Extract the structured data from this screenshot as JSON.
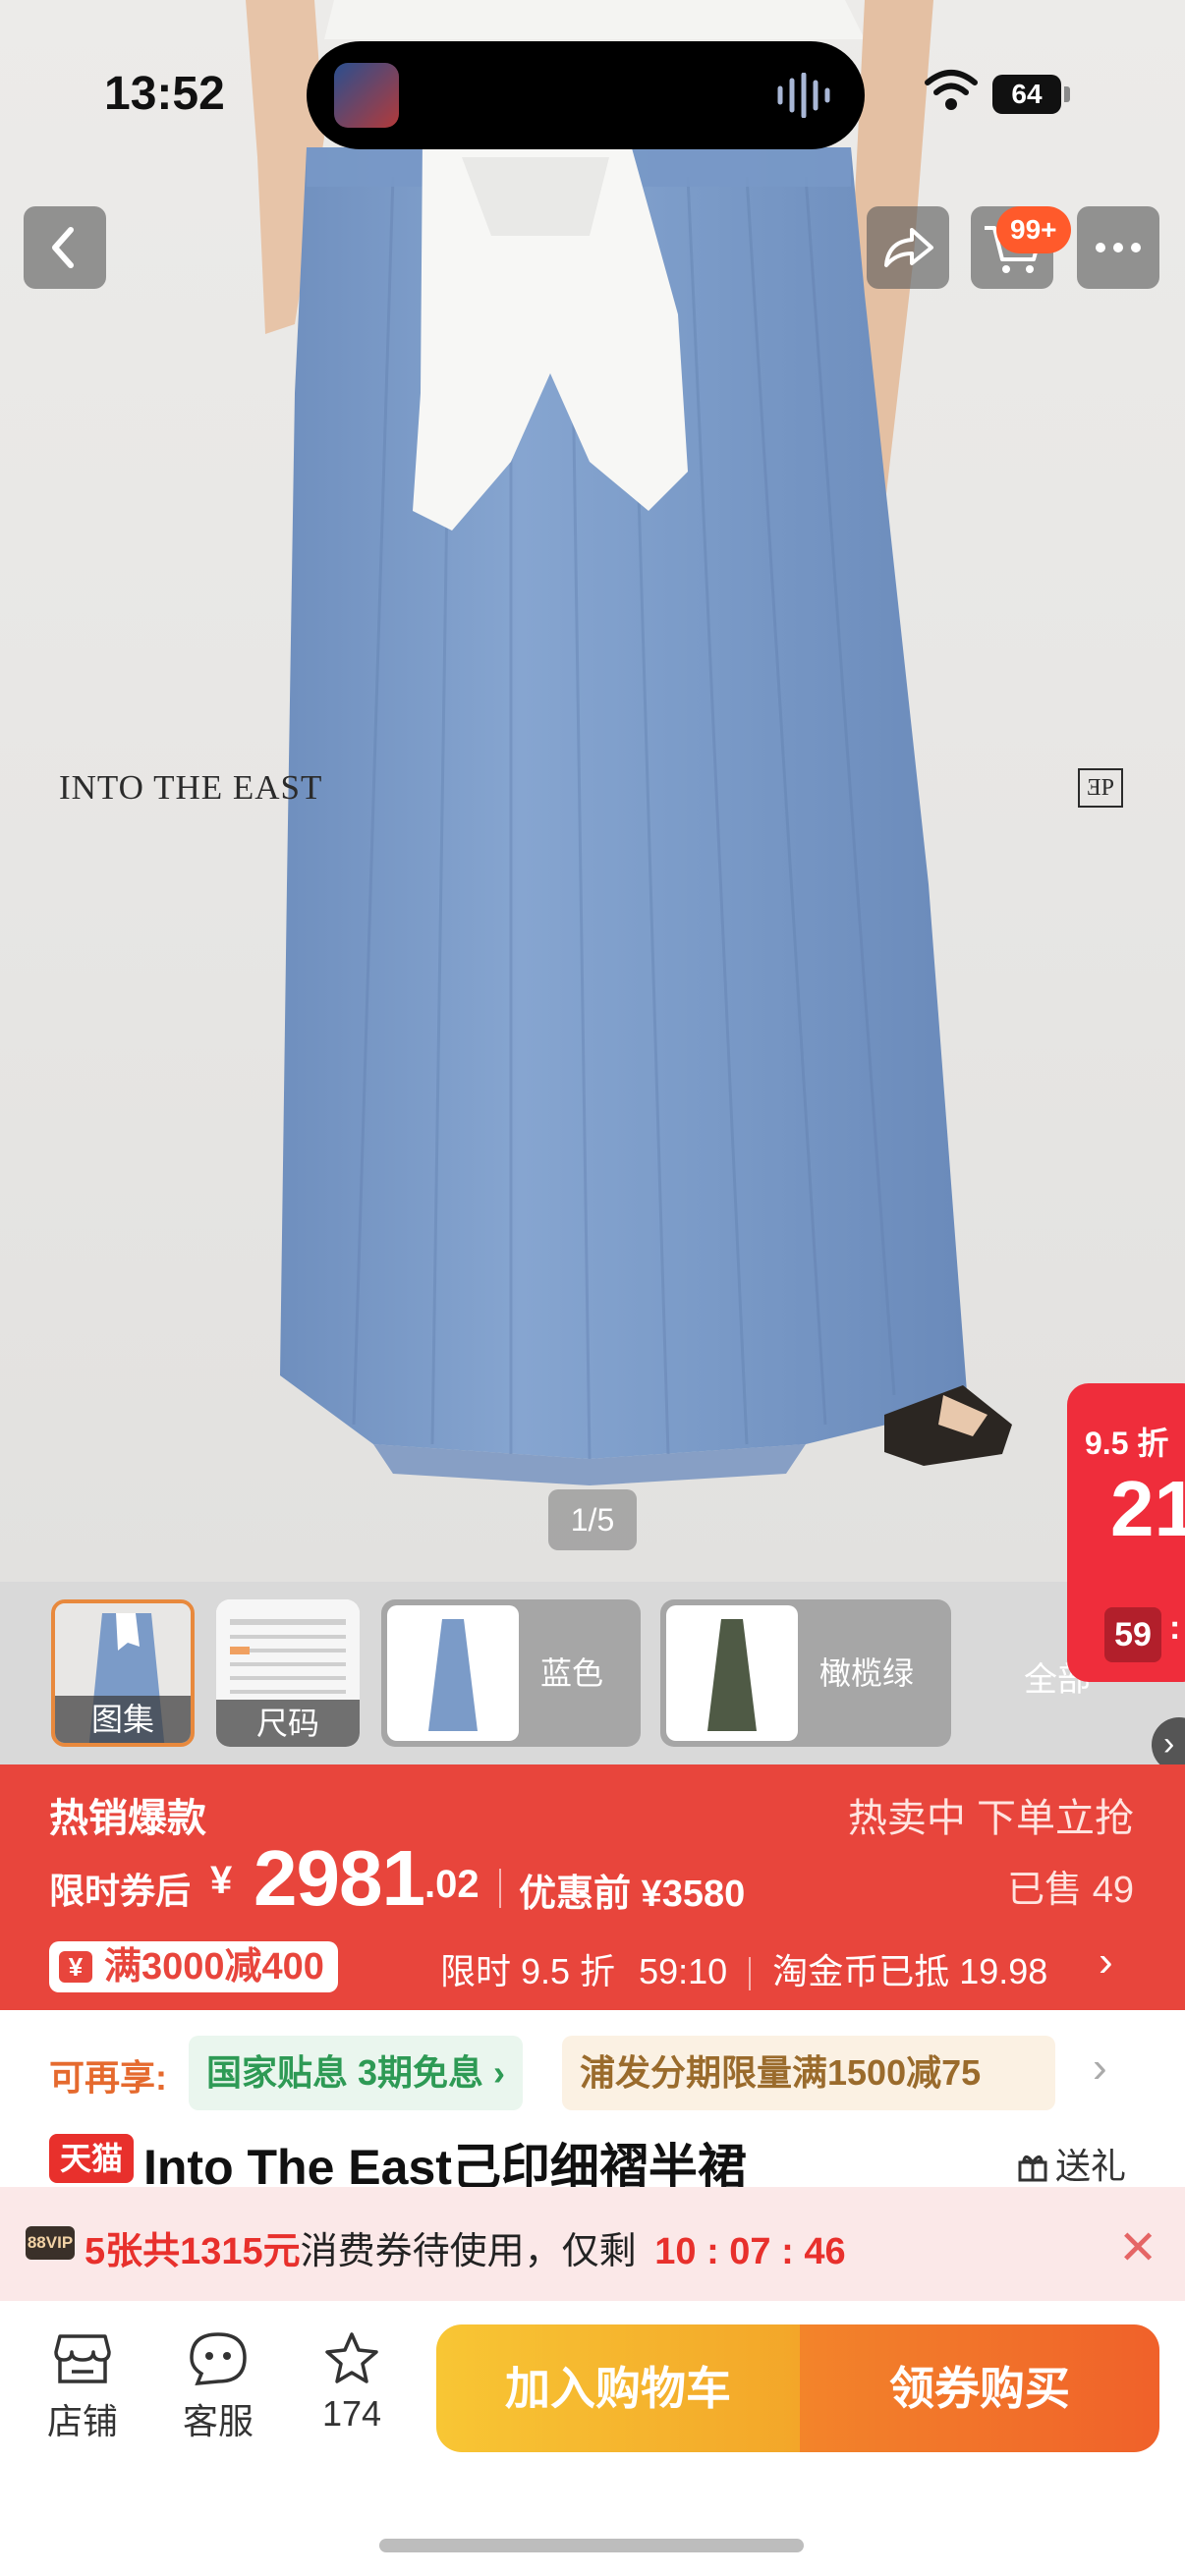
{
  "status_bar": {
    "time": "13:52",
    "battery": "64"
  },
  "nav": {
    "cart_badge": "99+"
  },
  "hero": {
    "brand_left": "INTO THE EAST",
    "brand_right": "ƎP",
    "page_indicator": "1/5"
  },
  "float_promo": {
    "discount": "9.5 折",
    "countdown_big": "21",
    "countdown_sec": "59"
  },
  "thumbnails": {
    "gallery_label": "图集",
    "size_label": "尺码",
    "color1_label": "蓝色",
    "color2_label": "橄榄绿",
    "all_label": "全部"
  },
  "price_banner": {
    "hot_label": "热销爆款",
    "selling_label": "热卖中 下单立抢",
    "after_coupon_label": "限时券后",
    "currency": "¥",
    "price_int": "2981",
    "price_dec": ".02",
    "before_label": "优惠前 ¥3580",
    "sold_label": "已售 49",
    "coupon_mark": "¥",
    "coupon_text": "满3000减400",
    "limited_discount": "限时 9.5 折",
    "limited_time": "59:10",
    "coin_text": "淘金币已抵 19.98"
  },
  "benefits": {
    "label": "可再享:",
    "chip1": "国家贴息 3期免息",
    "chip2": "浦发分期限量满1500减75"
  },
  "title": {
    "badge": "天猫",
    "text": "Into The East己印细褶半裙",
    "gift": "送礼"
  },
  "vip_bar": {
    "badge": "88VIP",
    "count_text": "5张共1315元",
    "mid_text": "消费券待使用，仅剩",
    "countdown": "10 : 07 : 46"
  },
  "bottom_bar": {
    "store_label": "店铺",
    "service_label": "客服",
    "fav_count": "174",
    "add_cart_label": "加入购物车",
    "buy_label": "领券购买"
  },
  "colors": {
    "accent_red": "#e8453c",
    "cart_yellow": "#f8c634",
    "buy_orange": "#f0612a",
    "skirt_blue": "#7a9bc8"
  }
}
